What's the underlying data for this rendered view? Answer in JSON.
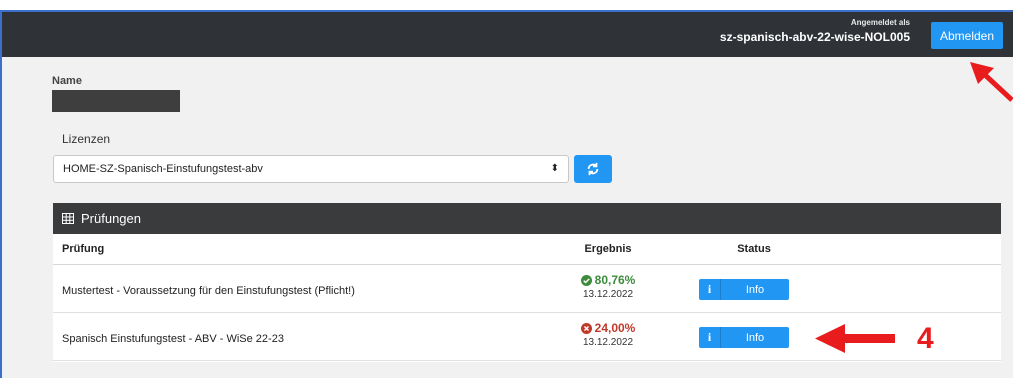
{
  "header": {
    "login_caption": "Angemeldet als",
    "login_user": "sz-spanisch-abv-22-wise-NOL005",
    "logout_label": "Abmelden"
  },
  "form": {
    "name_label": "Name",
    "licenses_label": "Lizenzen",
    "license_selected": "HOME-SZ-Spanisch-Einstufungstest-abv"
  },
  "exams": {
    "title": "Prüfungen",
    "columns": {
      "exam": "Prüfung",
      "result": "Ergebnis",
      "status": "Status"
    },
    "rows": [
      {
        "name": "Mustertest - Voraussetzung für den Einstufungstest (Pflicht!)",
        "result": "80,76%",
        "date": "13.12.2022",
        "outcome": "passed",
        "info_label": "Info"
      },
      {
        "name": "Spanisch Einstufungstest - ABV - WiSe 22-23",
        "result": "24,00%",
        "date": "13.12.2022",
        "outcome": "failed",
        "info_label": "Info"
      }
    ]
  },
  "annotation": {
    "step": "4",
    "color": "#e81c1c"
  },
  "colors": {
    "accent": "#2196f3",
    "topbar": "#2f3338",
    "pass": "#3c8c3c",
    "fail": "#c0392b"
  }
}
